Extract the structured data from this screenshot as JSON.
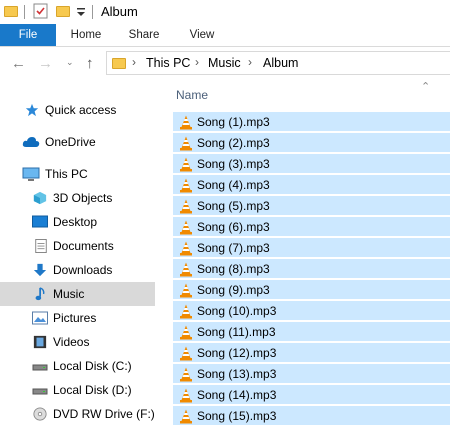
{
  "window": {
    "title": "Album"
  },
  "ribbon": {
    "tabs": [
      "File",
      "Home",
      "Share",
      "View"
    ]
  },
  "address": {
    "crumbs": [
      "This PC",
      "Music",
      "Album"
    ]
  },
  "columns": {
    "name": "Name"
  },
  "nav": [
    {
      "label": "Quick access",
      "icon": "star-icon"
    },
    {
      "label": "OneDrive",
      "icon": "cloud-icon"
    },
    {
      "label": "This PC",
      "icon": "computer-icon"
    },
    {
      "label": "3D Objects",
      "icon": "cube-icon"
    },
    {
      "label": "Desktop",
      "icon": "desktop-icon"
    },
    {
      "label": "Documents",
      "icon": "document-icon"
    },
    {
      "label": "Downloads",
      "icon": "download-icon"
    },
    {
      "label": "Music",
      "icon": "music-note-icon",
      "selected": true
    },
    {
      "label": "Pictures",
      "icon": "picture-icon"
    },
    {
      "label": "Videos",
      "icon": "film-icon"
    },
    {
      "label": "Local Disk (C:)",
      "icon": "drive-icon"
    },
    {
      "label": "Local Disk (D:)",
      "icon": "drive-icon"
    },
    {
      "label": "DVD RW Drive (F:)",
      "icon": "disc-icon"
    }
  ],
  "files": [
    "Song (1).mp3",
    "Song (2).mp3",
    "Song (3).mp3",
    "Song (4).mp3",
    "Song (5).mp3",
    "Song (6).mp3",
    "Song (7).mp3",
    "Song (8).mp3",
    "Song (9).mp3",
    "Song (10).mp3",
    "Song (11).mp3",
    "Song (12).mp3",
    "Song (13).mp3",
    "Song (14).mp3",
    "Song (15).mp3"
  ],
  "colors": {
    "selection": "#cce8ff",
    "accent": "#1979ca",
    "nav_selected": "#d9d9d9"
  }
}
